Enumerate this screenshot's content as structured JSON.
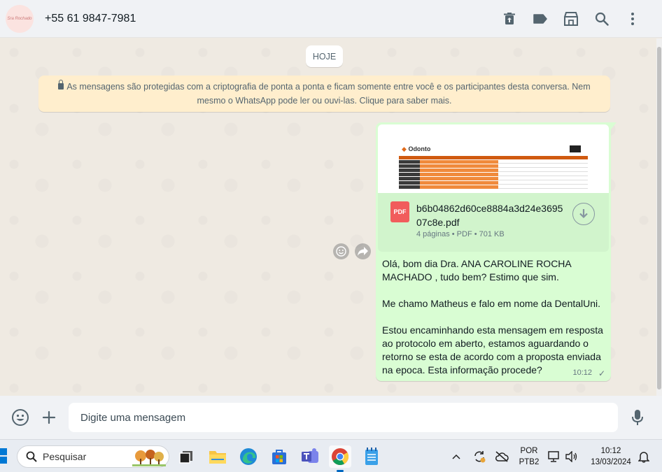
{
  "header": {
    "avatar_text": "Sra Rochado",
    "contact": "+55 61 9847-7981"
  },
  "chat": {
    "date": "HOJE",
    "encryption_notice": "As mensagens são protegidas com a criptografia de ponta a ponta e ficam somente entre você e os participantes desta conversa. Nem mesmo o WhatsApp pode ler ou ouvi-las. Clique para saber mais.",
    "message": {
      "doc_logo": "Odonto",
      "file_name": "b6b04862d60ce8884a3d24e369507c8e.pdf",
      "file_icon": "PDF",
      "file_meta": "4 páginas • PDF • 701 KB",
      "text": "Olá, bom dia Dra. ANA CAROLINE ROCHA MACHADO , tudo bem? Estimo que sim.\n\nMe chamo Matheus e falo em nome da DentalUni.\n\nEstou encaminhando esta mensagem em resposta ao protocolo em aberto, estamos aguardando o retorno se esta de acordo com a proposta enviada na epoca. Esta informação procede?",
      "time": "10:12",
      "check": "✓"
    }
  },
  "composer": {
    "placeholder": "Digite uma mensagem"
  },
  "taskbar": {
    "search": "Pesquisar",
    "lang_top": "POR",
    "lang_bottom": "PTB2",
    "clock_time": "10:12",
    "clock_date": "13/03/2024"
  },
  "colors": {
    "bubble": "#d9fdd3",
    "notice": "#ffeecd",
    "pdf": "#f15c5c"
  }
}
